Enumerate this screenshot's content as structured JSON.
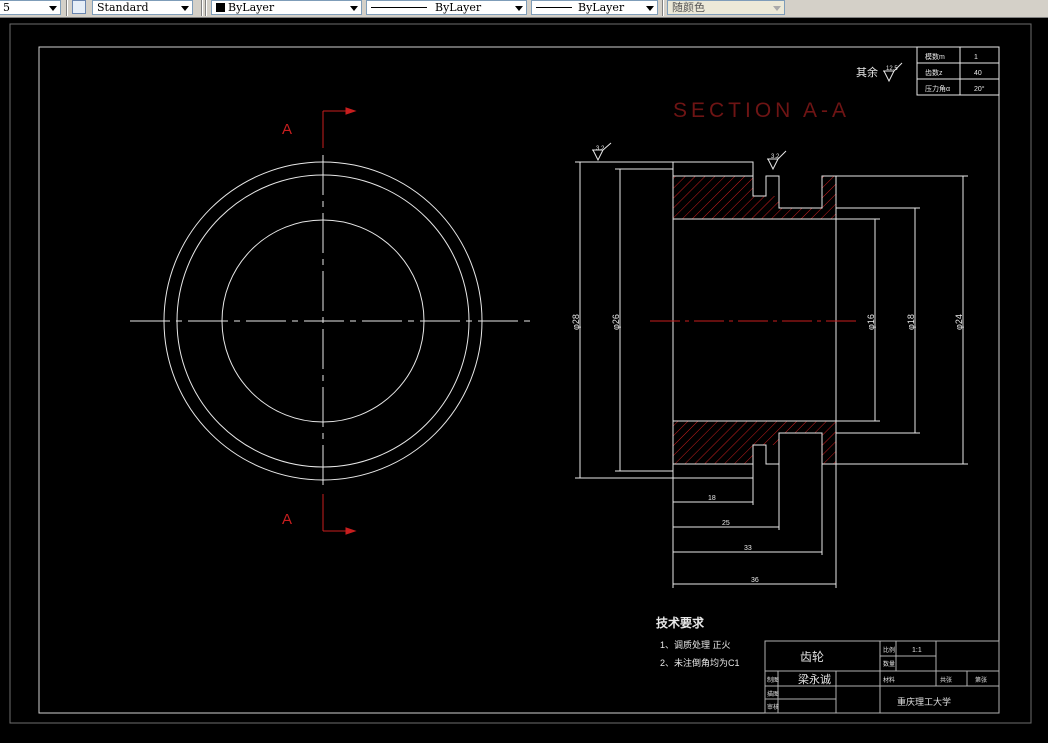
{
  "toolbar": {
    "first_combo_value": "5",
    "text_style": "Standard",
    "layer_color": "ByLayer",
    "linetype": "ByLayer",
    "lineweight": "ByLayer",
    "plot_color": "随颜色"
  },
  "drawing": {
    "section_title": "SECTION A-A",
    "cut_label_top": "A",
    "cut_label_bottom": "A",
    "roughness_other": "其余",
    "roughness_other_value": "12.5",
    "roughness_left_value": "3.2",
    "roughness_mid_value": "3.2",
    "dim_d28": "φ28",
    "dim_d26": "φ26",
    "dim_d16": "φ16",
    "dim_d18": "φ18",
    "dim_d24": "φ24",
    "dim_18": "18",
    "dim_25": "25",
    "dim_33": "33",
    "dim_36": "36",
    "param_table": {
      "rows": [
        {
          "label": "模数m",
          "value": "1"
        },
        {
          "label": "齿数z",
          "value": "40"
        },
        {
          "label": "压力角α",
          "value": "20°"
        }
      ]
    },
    "tech_req_title": "技术要求",
    "tech_req_items": [
      "1、调质处理 正火",
      "2、未注倒角均为C1"
    ],
    "title_block": {
      "part_name": "齿轮",
      "drawer": "梁永诚",
      "scale_label": "比例",
      "scale_value": "1:1",
      "qty_label": "数量",
      "sheet_label": "共张",
      "weight_label": "材料",
      "sheet_no": "第张",
      "row_labels": [
        "制图",
        "描图",
        "审核"
      ],
      "school": "重庆理工大学"
    }
  },
  "colors": {
    "background": "#000000",
    "lines": "#ffffff",
    "hatch_and_cut": "#c81e1e",
    "toolbar": "#d4d0c8"
  }
}
